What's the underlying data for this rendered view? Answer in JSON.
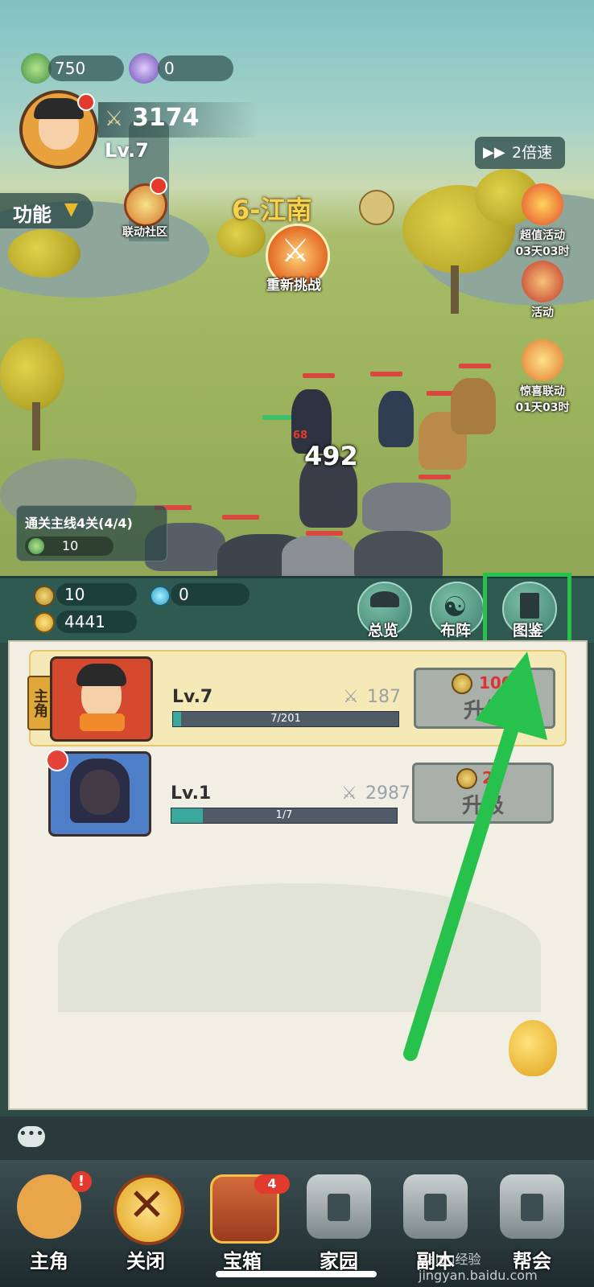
{
  "resources": {
    "jade": "750",
    "orb": "0"
  },
  "player": {
    "power": "3174",
    "level": "Lv.7"
  },
  "speed_button": "2倍速",
  "function_button": "功能",
  "community": "联动社区",
  "stage": {
    "title": "6-江南",
    "challenge": "重新挑战"
  },
  "side_events": [
    {
      "label": "超值活动",
      "timer": "03天03时"
    },
    {
      "label": "活动",
      "timer": ""
    },
    {
      "label": "惊喜联动",
      "timer": "01天03时"
    }
  ],
  "battle": {
    "damage": "492",
    "small_damage": "68"
  },
  "quest": {
    "title": "通关主线4关(4/4)",
    "reward": "10"
  },
  "currencies": {
    "coin": "10",
    "gem": "0",
    "gold": "4441"
  },
  "panel_buttons": {
    "overview": "总览",
    "formation": "布阵",
    "codex": "图鉴"
  },
  "heroes": [
    {
      "tag": "主角",
      "level": "Lv.7",
      "power": "187",
      "exp": "7/201",
      "exp_fraction": 0.035,
      "cost": "100",
      "button": "升级"
    },
    {
      "tag": "",
      "level": "Lv.1",
      "power": "2987",
      "exp": "1/7",
      "exp_fraction": 0.14,
      "cost": "2",
      "button": "升级"
    }
  ],
  "nav": [
    {
      "label": "主角",
      "badge": "!"
    },
    {
      "label": "关闭",
      "badge": ""
    },
    {
      "label": "宝箱",
      "badge": "4"
    },
    {
      "label": "家园",
      "badge": ""
    },
    {
      "label": "副本",
      "badge": ""
    },
    {
      "label": "帮会",
      "badge": ""
    }
  ],
  "watermark": "Baidu经验 jingyan.baidu.com",
  "colors": {
    "highlight": "#27c24c",
    "accent": "#e8a31d"
  }
}
